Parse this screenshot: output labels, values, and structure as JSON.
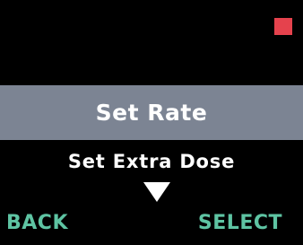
{
  "colors": {
    "background": "#000000",
    "highlight": "#7c8493",
    "text": "#ffffff",
    "softkey": "#5ec4a3",
    "status": "#e5424d"
  },
  "status_indicator": {
    "icon": "red-square-icon"
  },
  "menu": {
    "selected_item": "Set Rate",
    "next_item": "Set Extra Dose",
    "scroll_icon": "triangle-down-icon"
  },
  "softkeys": {
    "back_label": "BACK",
    "select_label": "SELECT"
  }
}
